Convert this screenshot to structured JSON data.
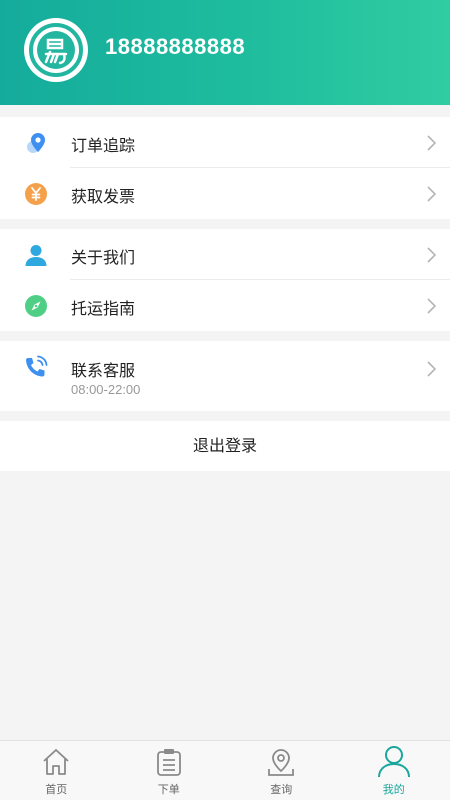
{
  "profile": {
    "phone": "18888888888"
  },
  "groups": [
    {
      "items": [
        {
          "label": "订单追踪"
        },
        {
          "label": "获取发票"
        }
      ]
    },
    {
      "items": [
        {
          "label": "关于我们"
        },
        {
          "label": "托运指南"
        }
      ]
    },
    {
      "items": [
        {
          "label": "联系客服",
          "sub": "08:00-22:00"
        }
      ]
    }
  ],
  "logout_label": "退出登录",
  "tabs": [
    {
      "label": "首页"
    },
    {
      "label": "下单"
    },
    {
      "label": "查询"
    },
    {
      "label": "我的"
    }
  ],
  "colors": {
    "accent": "#1aa79c",
    "invoice_icon": "#f5a04a",
    "guide_icon": "#4fcf86",
    "user_icon": "#2fa8e0",
    "track_icon": "#3d8ff0"
  }
}
